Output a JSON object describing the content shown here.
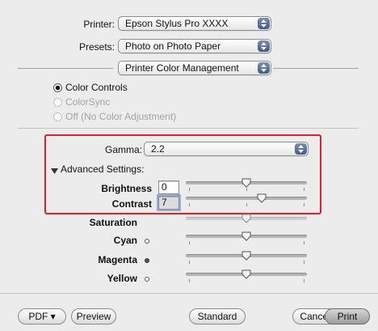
{
  "printer": {
    "label": "Printer:",
    "value": "Epson Stylus Pro XXXX"
  },
  "presets": {
    "label": "Presets:",
    "value": "Photo on Photo Paper"
  },
  "panel": {
    "value": "Printer Color Management"
  },
  "color_mode": {
    "options": [
      {
        "label": "Color Controls",
        "selected": true,
        "enabled": true
      },
      {
        "label": "ColorSync",
        "selected": false,
        "enabled": false
      },
      {
        "label": "Off (No Color Adjustment)",
        "selected": false,
        "enabled": false
      }
    ]
  },
  "gamma": {
    "label": "Gamma:",
    "value": "2.2"
  },
  "advanced": {
    "label": "Advanced Settings:",
    "expanded": true
  },
  "brightness": {
    "label": "Brightness",
    "value": "0",
    "level": 0.5
  },
  "contrast": {
    "label": "Contrast",
    "value": "7",
    "level": 0.6
  },
  "saturation": {
    "label": "Saturation",
    "level": 0.5,
    "enabled": false
  },
  "cyan": {
    "label": "Cyan",
    "level": 0.5
  },
  "magenta": {
    "label": "Magenta",
    "level": 0.5
  },
  "yellow": {
    "label": "Yellow",
    "level": 0.5
  },
  "buttons": {
    "pdf": "PDF ▾",
    "preview": "Preview",
    "standard": "Standard",
    "cancel": "Cancel",
    "print": "Print"
  },
  "colors": {
    "highlight": "#e0202b",
    "popup_arrows": "#3f5a8c"
  },
  "icons": {
    "popup": "updown-arrows-icon",
    "slider_thumb": "slider-thumb-icon",
    "disclosure": "disclosure-triangle-icon"
  }
}
